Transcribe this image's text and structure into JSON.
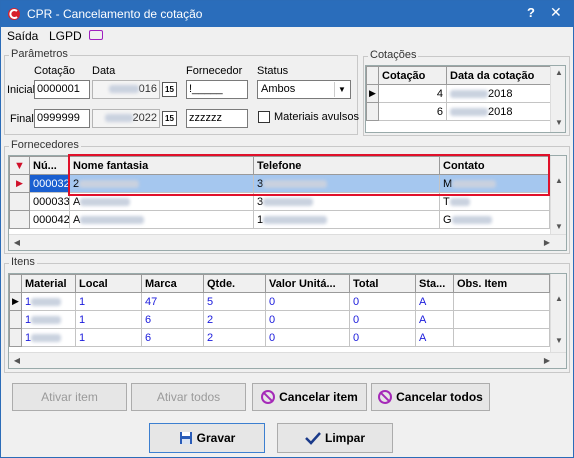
{
  "window": {
    "title": "CPR - Cancelamento de cotação",
    "help": "?",
    "close": "✕"
  },
  "menu": {
    "saida": "Saída",
    "lgpd": "LGPD"
  },
  "parametros": {
    "group_label": "Parâmetros",
    "col_cotacao": "Cotação",
    "col_data": "Data",
    "col_fornecedor": "Fornecedor",
    "col_status": "Status",
    "row_inicial": "Inicial",
    "row_final": "Final",
    "cotacao_inicial": "0000001",
    "cotacao_final": "0999999",
    "data_inicial_suffix": "016",
    "data_final_suffix": "2022",
    "fornecedor_inicial": "!_____",
    "fornecedor_final": "zzzzzz",
    "status_value": "Ambos",
    "materiais_avulsos": "Materiais avulsos",
    "cal_icon_text": "15"
  },
  "cotacoes": {
    "group_label": "Cotações",
    "headers": [
      "Cotação",
      "Data da cotação"
    ],
    "rows": [
      {
        "cotacao": "4",
        "data_suffix": "2018"
      },
      {
        "cotacao": "6",
        "data_suffix": "2018"
      }
    ]
  },
  "fornecedores": {
    "group_label": "Fornecedores",
    "headers": [
      "Nú...",
      "Nome fantasia",
      "Telefone",
      "Contato"
    ],
    "rows": [
      {
        "num": "000032",
        "nome": "2",
        "telefone": "3",
        "contato": "M"
      },
      {
        "num": "000033",
        "nome": "A",
        "telefone": "3",
        "contato": "T"
      },
      {
        "num": "000042",
        "nome": "A",
        "telefone": "1",
        "contato": "G"
      }
    ]
  },
  "itens": {
    "group_label": "Itens",
    "headers": [
      "Material",
      "Local",
      "Marca",
      "Qtde.",
      "Valor Unitá...",
      "Total",
      "Sta...",
      "Obs. Item"
    ],
    "rows": [
      {
        "material": "1",
        "local": "1",
        "marca": "47",
        "qtde": "5",
        "valor": "0",
        "total": "0",
        "status": "A",
        "obs": ""
      },
      {
        "material": "1",
        "local": "1",
        "marca": "6",
        "qtde": "2",
        "valor": "0",
        "total": "0",
        "status": "A",
        "obs": ""
      },
      {
        "material": "1",
        "local": "1",
        "marca": "6",
        "qtde": "2",
        "valor": "0",
        "total": "0",
        "status": "A",
        "obs": ""
      }
    ]
  },
  "buttons": {
    "ativar_item": "Ativar item",
    "ativar_todos": "Ativar todos",
    "cancelar_item": "Cancelar item",
    "cancelar_todos": "Cancelar todos",
    "gravar": "Gravar",
    "limpar": "Limpar"
  },
  "colors": {
    "titlebar": "#2a6dbb",
    "selection": "#a5c7ef",
    "highlight_box": "#e0102a",
    "link_blue": "#1a1adc"
  }
}
